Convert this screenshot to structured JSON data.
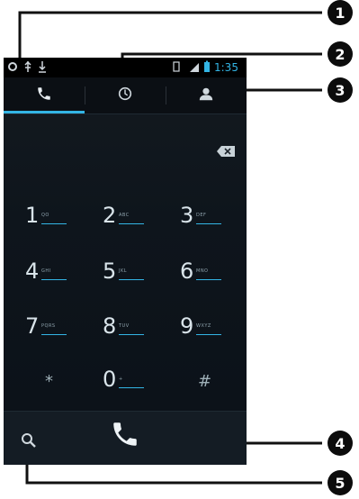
{
  "status_bar": {
    "time": "1:35",
    "icons": [
      "settings-icon",
      "usb-icon",
      "download-icon",
      "vibrate-icon",
      "signal-icon",
      "battery-icon"
    ]
  },
  "tabs": [
    {
      "name": "phone",
      "icon": "phone-icon",
      "selected": true
    },
    {
      "name": "call-log",
      "icon": "clock-icon",
      "selected": false
    },
    {
      "name": "contacts",
      "icon": "person-icon",
      "selected": false
    }
  ],
  "dialpad": {
    "keys": [
      {
        "num": "1",
        "letters": "QO"
      },
      {
        "num": "2",
        "letters": "ABC"
      },
      {
        "num": "3",
        "letters": "DEF"
      },
      {
        "num": "4",
        "letters": "GHI"
      },
      {
        "num": "5",
        "letters": "JKL"
      },
      {
        "num": "6",
        "letters": "MNO"
      },
      {
        "num": "7",
        "letters": "PQRS"
      },
      {
        "num": "8",
        "letters": "TUV"
      },
      {
        "num": "9",
        "letters": "WXYZ"
      },
      {
        "num": "*",
        "letters": ""
      },
      {
        "num": "0",
        "letters": "+"
      },
      {
        "num": "#",
        "letters": ""
      }
    ]
  },
  "callouts": [
    "1",
    "2",
    "3",
    "4",
    "5"
  ],
  "colors": {
    "accent": "#33b5e5",
    "background": "#0e151c",
    "callout": "#0c0c0c"
  }
}
